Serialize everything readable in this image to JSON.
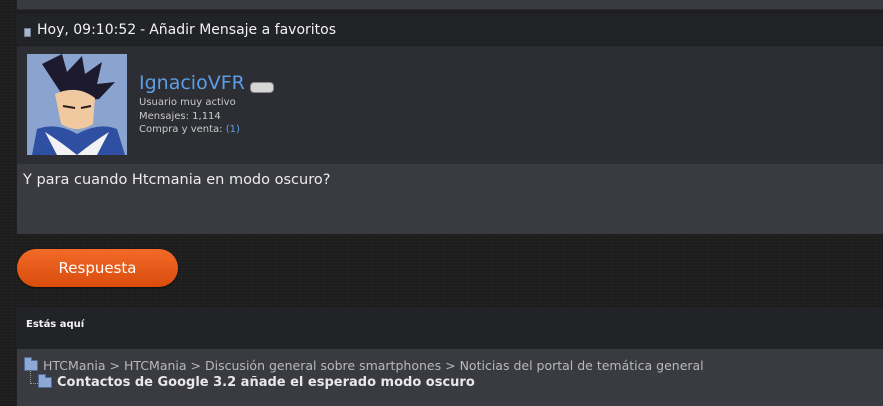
{
  "post": {
    "time": "Hoy, 09:10:52",
    "separator": "-",
    "favorite_link": "Añadir Mensaje a favoritos",
    "message": "Y para cuando Htcmania en modo oscuro?"
  },
  "user": {
    "name": "IgnacioVFR",
    "rank": "Usuario muy activo",
    "messages_label": "Mensajes:",
    "messages_count": "1,114",
    "trade_label": "Compra y venta:",
    "trade_count": "(1)"
  },
  "actions": {
    "reply_label": "Respuesta"
  },
  "location": {
    "heading": "Estás aquí",
    "breadcrumbs": [
      "HTCMania",
      "HTCMania",
      "Discusión general sobre smartphones",
      "Noticias del portal de temática general"
    ],
    "breadcrumb_sep": ">",
    "current": "Contactos de Google 3.2 añade el esperado modo oscuro"
  },
  "colors": {
    "accent_orange": "#e85a18",
    "username_blue": "#5c9ee8"
  }
}
